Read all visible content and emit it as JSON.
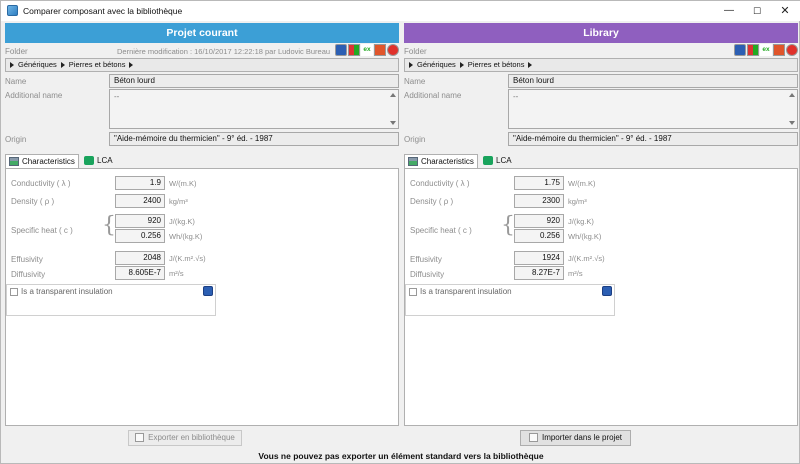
{
  "window": {
    "title": "Comparer composant avec la bibliothèque",
    "min_glyph": "—",
    "max_glyph": "☐",
    "close_glyph": "✕"
  },
  "labels": {
    "folder": "Folder",
    "name": "Name",
    "additional_name": "Additional name",
    "origin": "Origin",
    "conductivity": "Conductivity ( λ )",
    "density": "Density ( ρ )",
    "specific_heat": "Specific heat ( c )",
    "effusivity": "Effusivity",
    "diffusivity": "Diffusivity",
    "transparent": "Is a transparent insulation",
    "tab_characteristics": "Characteristics",
    "tab_lca": "LCA"
  },
  "units": {
    "conductivity": "W/(m.K)",
    "density": "kg/m³",
    "specific_heat_1": "J/(kg.K)",
    "specific_heat_2": "Wh/(kg.K)",
    "effusivity": "J/(K.m².√s)",
    "diffusivity": "m²/s"
  },
  "toolbar_icons": [
    "gear-icon",
    "windows-icon",
    "excel-icon",
    "home-icon",
    "delete-icon"
  ],
  "left": {
    "header": "Projet courant",
    "header_color": "#3c9fd6",
    "modification": "Dernière modification : 16/10/2017 12:22:18 par Ludovic Bureau",
    "path": [
      "Génériques",
      "Pierres et bétons"
    ],
    "name": "Béton lourd",
    "additional_name": "--",
    "origin": "\"Aide-mémoire du thermicien\" - 9° éd. - 1987",
    "conductivity": "1.9",
    "density": "2400",
    "specific_heat_1": "920",
    "specific_heat_2": "0.256",
    "effusivity": "2048",
    "diffusivity": "8.605E-7",
    "button": "Exporter en bibliothèque"
  },
  "right": {
    "header": "Library",
    "header_color": "#8f5fbf",
    "path": [
      "Génériques",
      "Pierres et bétons"
    ],
    "name": "Béton lourd",
    "additional_name": "--",
    "origin": "\"Aide-mémoire du thermicien\" - 9° éd. - 1987",
    "conductivity": "1.75",
    "density": "2300",
    "specific_heat_1": "920",
    "specific_heat_2": "0.256",
    "effusivity": "1924",
    "diffusivity": "8.27E-7",
    "button": "Importer dans le projet"
  },
  "footer_message": "Vous ne pouvez pas exporter un élément standard vers la bibliothèque"
}
